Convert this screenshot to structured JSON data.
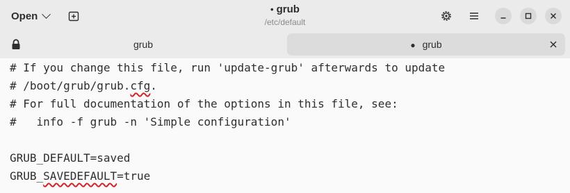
{
  "header": {
    "open_label": "Open",
    "title": "grub",
    "modified_marker": "•",
    "subtitle": "/etc/default"
  },
  "icons": {
    "new_tab": "new-tab-icon",
    "settings": "gear-icon",
    "menu": "hamburger-menu-icon",
    "minimize": "minimize-icon",
    "maximize": "maximize-icon",
    "close": "close-icon"
  },
  "tabs": [
    {
      "label": "grub",
      "readonly": true,
      "modified": false
    },
    {
      "label": "grub",
      "readonly": false,
      "modified": true,
      "marker": "●"
    }
  ],
  "editor": {
    "lines": [
      {
        "pre": "# If you change this file, run 'update-grub' afterwards to update",
        "typo": "",
        "post": ""
      },
      {
        "pre": "# /boot/grub/grub.",
        "typo": "cfg",
        "post": "."
      },
      {
        "pre": "# For full documentation of the options in this file, see:",
        "typo": "",
        "post": ""
      },
      {
        "pre": "#   info -f grub -n 'Simple configuration'",
        "typo": "",
        "post": ""
      },
      {
        "pre": "",
        "typo": "",
        "post": ""
      },
      {
        "pre": "GRUB_DEFAULT=saved",
        "typo": "",
        "post": ""
      },
      {
        "pre": "GRUB_",
        "typo": "SAVEDEFAULT",
        "post": "=true"
      }
    ]
  },
  "colors": {
    "background": "#fafafa",
    "headerbar": "#ebebeb",
    "active_tab": "#dcdcdc",
    "text": "#2e2e2e",
    "subtitle": "#8a8a8a",
    "spellcheck_underline": "#d22525"
  }
}
